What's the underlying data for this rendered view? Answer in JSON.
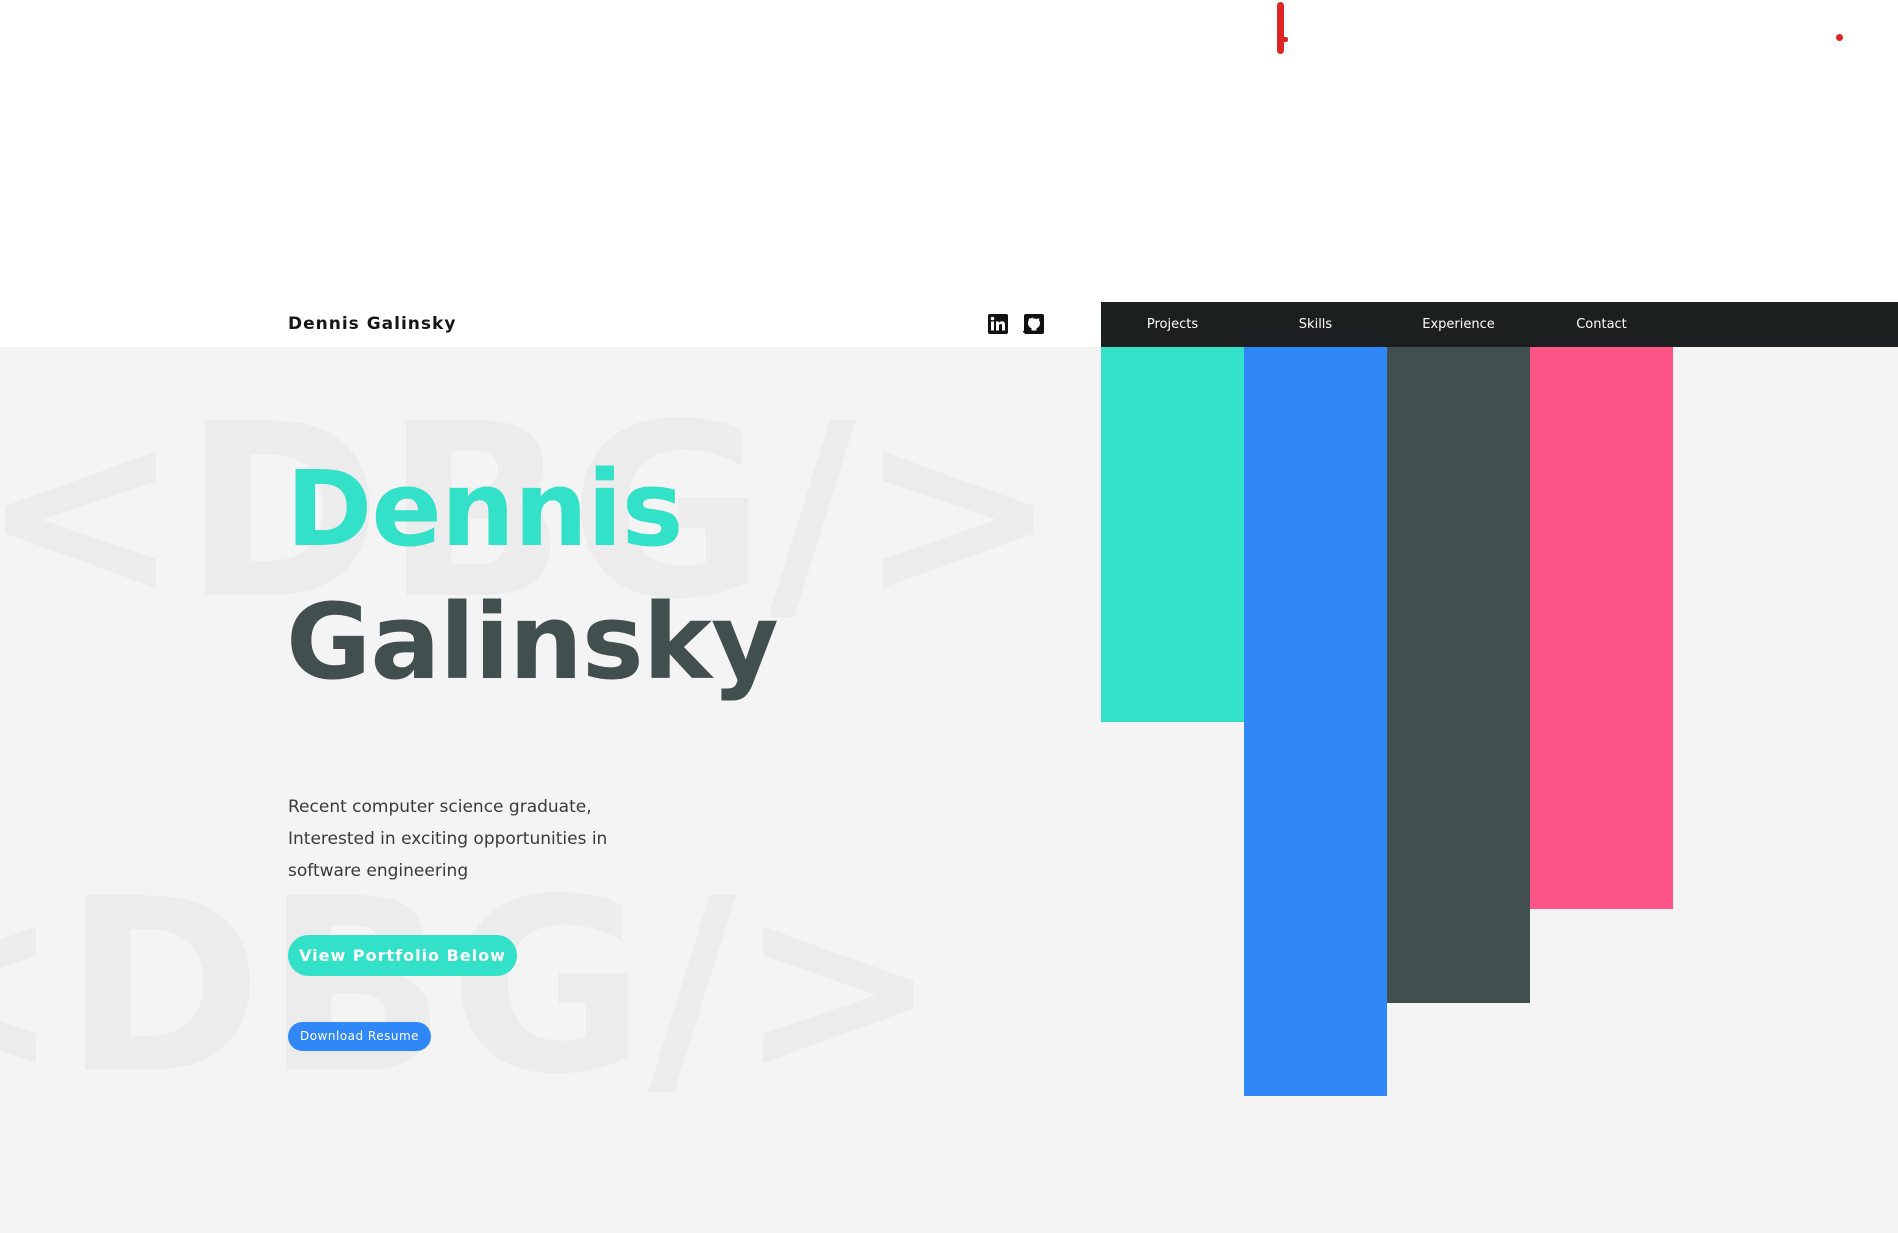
{
  "header": {
    "brand": "Dennis Galinsky",
    "social": [
      {
        "name": "linkedin-icon"
      },
      {
        "name": "github-icon"
      }
    ]
  },
  "nav": {
    "items": [
      {
        "label": "Projects"
      },
      {
        "label": "Skills"
      },
      {
        "label": "Experience"
      },
      {
        "label": "Contact"
      }
    ]
  },
  "hero": {
    "watermark_top": "<DBG/>",
    "watermark_bottom": "<DBG/>",
    "first_name": "Dennis",
    "last_name": "Galinsky",
    "tagline": [
      "Recent computer science graduate,",
      "Interested in exciting opportunities in",
      "software engineering"
    ],
    "portfolio_button": "View Portfolio Below",
    "resume_button": "Download Resume"
  },
  "colors": {
    "teal": "#33e0c8",
    "blue": "#3088f8",
    "slate": "#414f4e",
    "pink": "#fd5487",
    "nav_bg": "#1b1f1f",
    "hero_bg": "#f4f4f4",
    "red_mark": "#e02424"
  }
}
